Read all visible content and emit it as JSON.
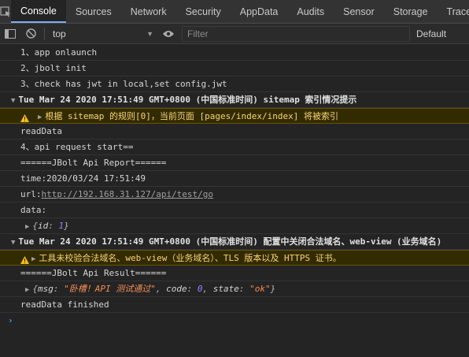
{
  "tabs": [
    {
      "label": "Console"
    },
    {
      "label": "Sources"
    },
    {
      "label": "Network"
    },
    {
      "label": "Security"
    },
    {
      "label": "AppData"
    },
    {
      "label": "Audits"
    },
    {
      "label": "Sensor"
    },
    {
      "label": "Storage"
    },
    {
      "label": "Trace"
    }
  ],
  "toolbar": {
    "context": "top",
    "filter_placeholder": "Filter",
    "levels": "Default"
  },
  "console": {
    "l1": "1、app onlaunch",
    "l2": "2、jbolt init",
    "l3": "3、check has jwt in local,set config.jwt",
    "g1": "Tue Mar 24 2020 17:51:49 GMT+0800 (中国标准时间) sitemap 索引情况提示",
    "w1": "根据 sitemap 的规则[0]，当前页面 [pages/index/index] 将被索引",
    "l4": "readData",
    "l5": "4、api request start==",
    "l6": "======JBolt Api Report======",
    "l7": "time:2020/03/24 17:51:49",
    "url_label": "url:",
    "url": "http://192.168.31.127/api/test/go",
    "l8": "data:",
    "data_obj_open": "{",
    "data_key": "id",
    "data_val": "1",
    "data_obj_close": "}",
    "g2": "Tue Mar 24 2020 17:51:49 GMT+0800 (中国标准时间) 配置中关闭合法域名、web-view (业务域名)",
    "w2": "工具未校验合法域名、web-view（业务域名）、TLS 版本以及 HTTPS 证书。",
    "l9": "======JBolt Api Result======",
    "res_msg_key": "msg",
    "res_msg_val": "\"卧槽！API 测试通过\"",
    "res_code_key": "code",
    "res_code_val": "0",
    "res_state_key": "state",
    "res_state_val": "\"ok\"",
    "l10": "readData finished",
    "prompt": "›"
  },
  "colors": {
    "accent": "#7cacf8",
    "warn_bg": "#332b00",
    "warn_text": "#f8d478"
  }
}
